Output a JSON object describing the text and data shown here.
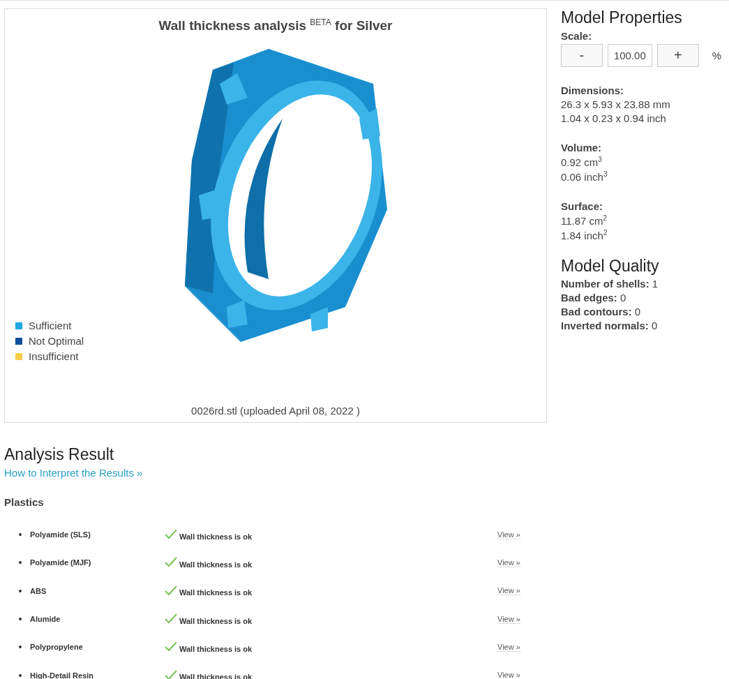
{
  "viewer": {
    "title": "Wall thickness analysis $^{BETA}$ for Silver",
    "legend": [
      {
        "label": "Sufficient",
        "color": "#1ea7e6"
      },
      {
        "label": "Not Optimal",
        "color": "#0a4f9e"
      },
      {
        "label": "Insufficient",
        "color": "#f7cd4a"
      }
    ],
    "file_caption": "0026rd.stl (uploaded April 08, 2022 )"
  },
  "model_properties": {
    "title": "Model Properties",
    "scale": {
      "label": "Scale:",
      "decrease": "-",
      "value": "100.00",
      "increase": "+",
      "unit": "%"
    },
    "groups": [
      {
        "label": "Dimensions:",
        "lines": [
          "26.3 x 5.93 x 23.88 mm",
          "1.04 x 0.23 x 0.94 inch"
        ]
      },
      {
        "label": "Volume:",
        "lines": [
          "0.92 cm$^{3}$",
          "0.06 inch$^{3}$"
        ]
      },
      {
        "label": "Surface:",
        "lines": [
          "11.87 cm$^{2}$",
          "1.84 inch$^{2}$"
        ]
      }
    ]
  },
  "model_quality": {
    "title": "Model Quality",
    "items": [
      {
        "label": "Number of shells:",
        "value": "1"
      },
      {
        "label": "Bad edges:",
        "value": "0"
      },
      {
        "label": "Bad contours:",
        "value": "0"
      },
      {
        "label": "Inverted normals:",
        "value": "0"
      }
    ]
  },
  "analysis": {
    "title": "Analysis Result",
    "link": "How to Interpret the Results »",
    "category": "Plastics",
    "rows": [
      {
        "material": "Polyamide (SLS)",
        "status": "Wall thickness is ok",
        "ok": true,
        "action": "View »"
      },
      {
        "material": "Polyamide (MJF)",
        "status": "Wall thickness is ok",
        "ok": true,
        "action": "View »"
      },
      {
        "material": "ABS",
        "status": "Wall thickness is ok",
        "ok": true,
        "action": "View »"
      },
      {
        "material": "Alumide",
        "status": "Wall thickness is ok",
        "ok": true,
        "action": "View »"
      },
      {
        "material": "Polypropylene",
        "status": "Wall thickness is ok",
        "ok": true,
        "action": "View »"
      },
      {
        "material": "High-Detail Resin",
        "status": "Wall thickness is ok",
        "ok": true,
        "action": "View »"
      }
    ]
  }
}
